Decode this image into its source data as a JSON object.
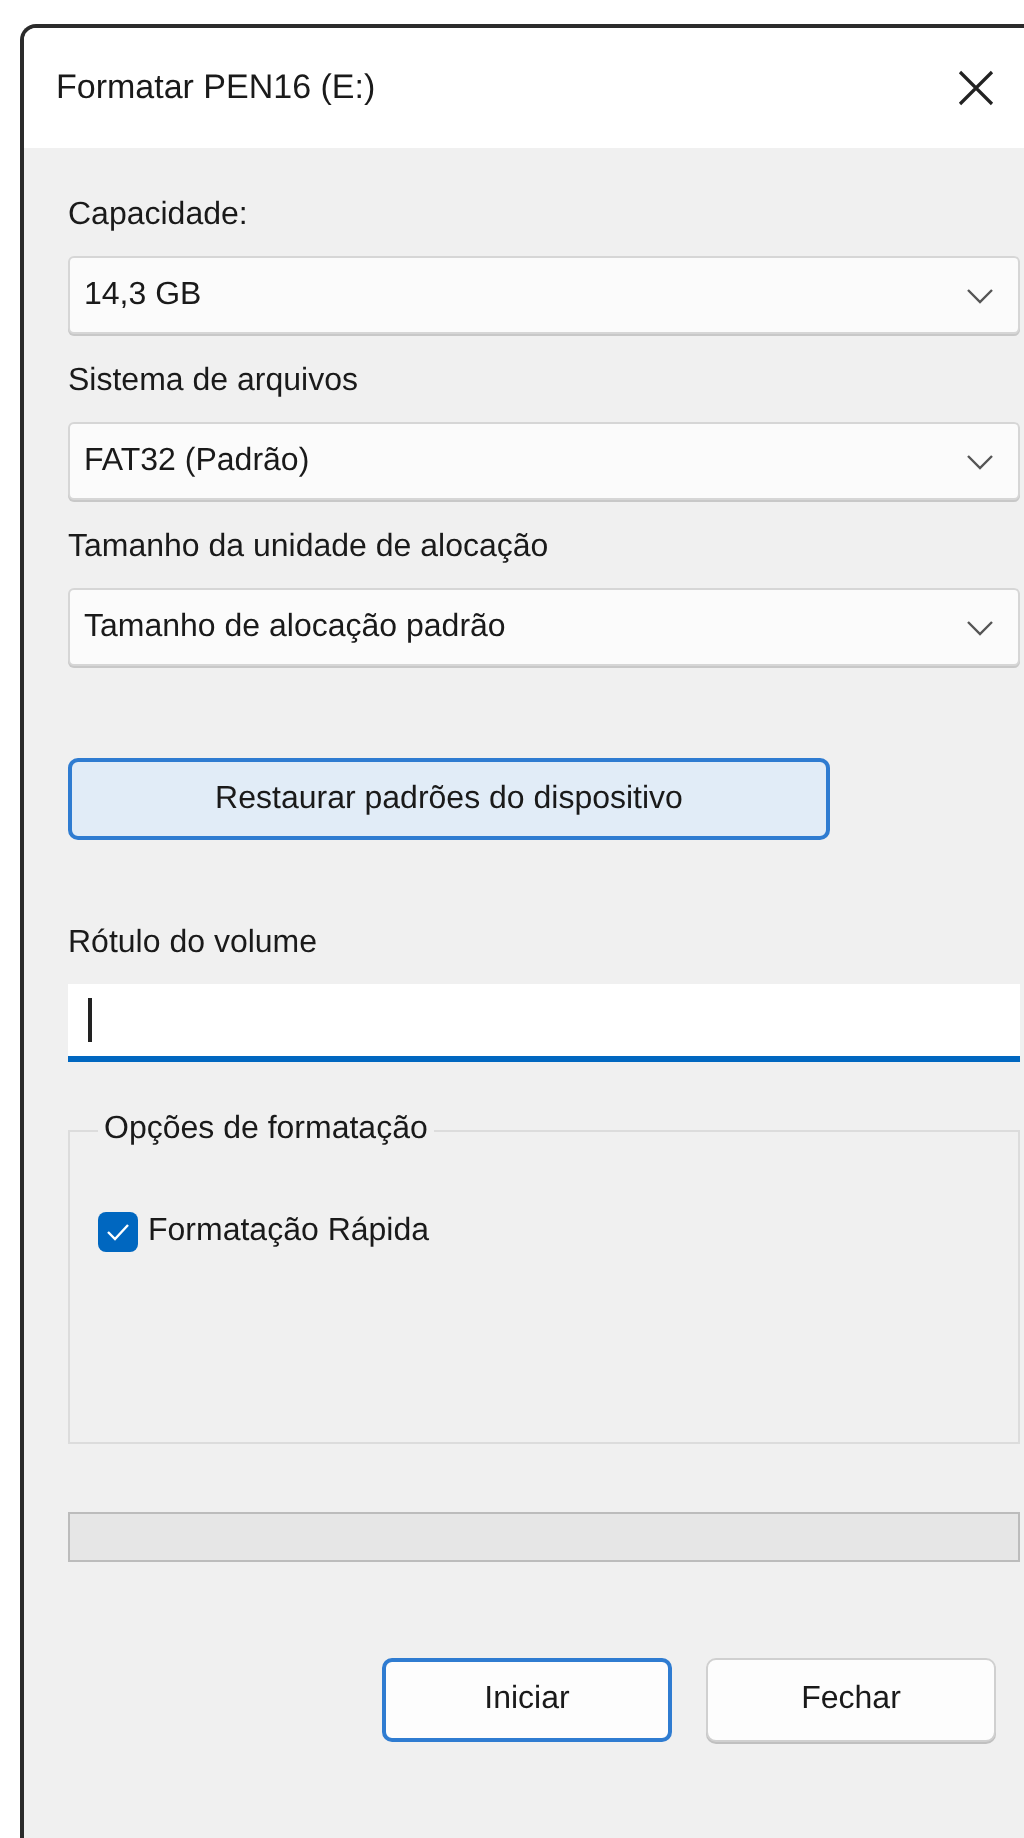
{
  "window": {
    "title": "Formatar PEN16 (E:)"
  },
  "fields": [
    {
      "label": "Capacidade:",
      "value": "14,3 GB"
    },
    {
      "label": "Sistema de arquivos",
      "value": "FAT32 (Padrão)"
    },
    {
      "label": "Tamanho da unidade de alocação",
      "value": "Tamanho de alocação padrão"
    }
  ],
  "restore_button": {
    "label": "Restaurar padrões do dispositivo"
  },
  "volume_label": {
    "label": "Rótulo do volume",
    "focused": true
  },
  "format_options": {
    "title": "Opções de formatação",
    "options": [
      {
        "label": "Formatação Rápida",
        "checked": true
      }
    ]
  },
  "progress": {
    "level": 0
  },
  "buttons": [
    {
      "label": "Iniciar",
      "default": true
    },
    {
      "label": "Fechar",
      "default": false
    }
  ]
}
